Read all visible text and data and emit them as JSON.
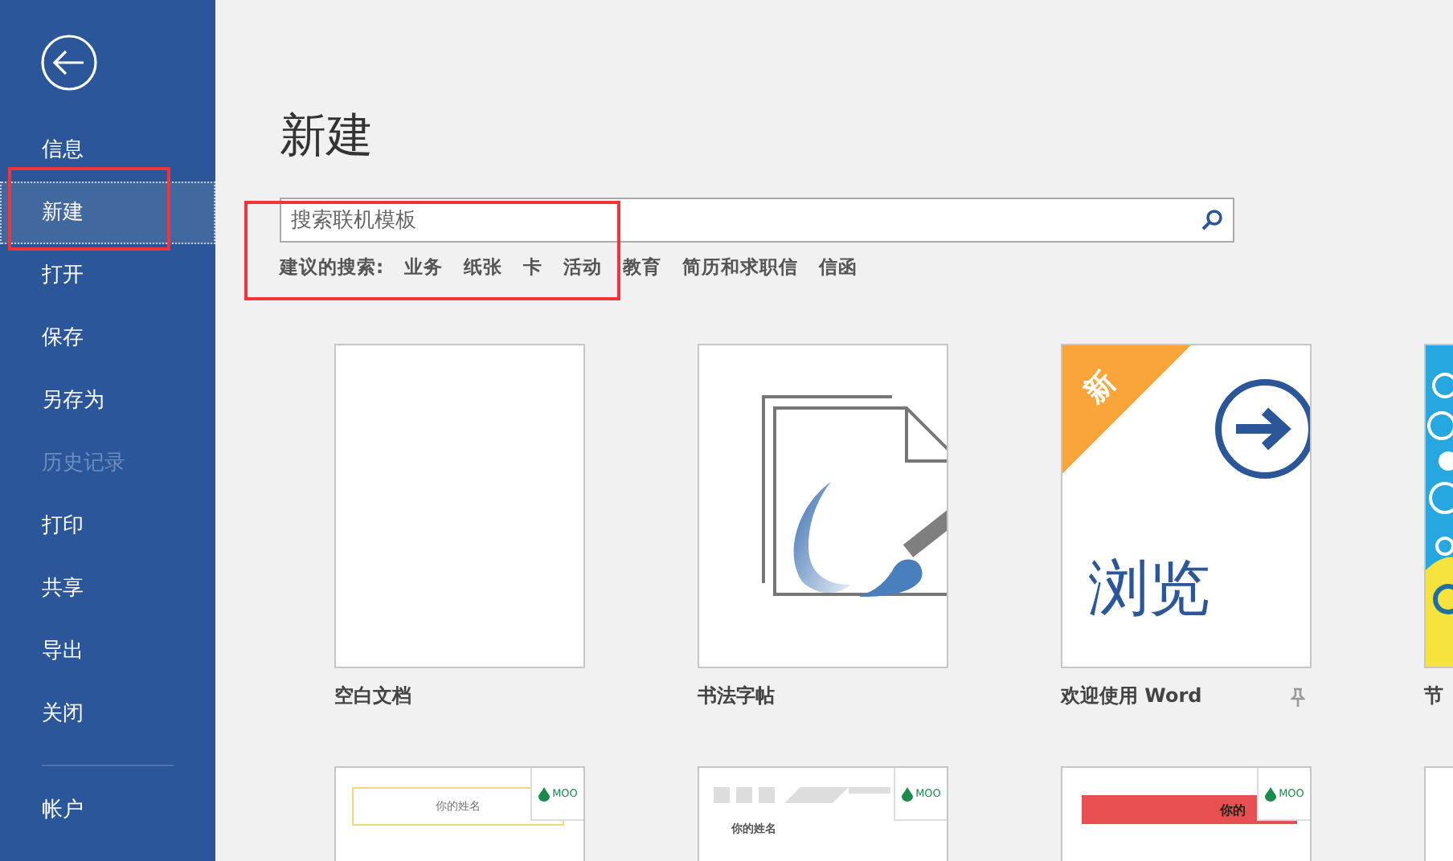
{
  "sidebar": {
    "items": [
      {
        "label": "信息",
        "selected": false,
        "disabled": false
      },
      {
        "label": "新建",
        "selected": true,
        "disabled": false
      },
      {
        "label": "打开",
        "selected": false,
        "disabled": false
      },
      {
        "label": "保存",
        "selected": false,
        "disabled": false
      },
      {
        "label": "另存为",
        "selected": false,
        "disabled": false
      },
      {
        "label": "历史记录",
        "selected": false,
        "disabled": true
      },
      {
        "label": "打印",
        "selected": false,
        "disabled": false
      },
      {
        "label": "共享",
        "selected": false,
        "disabled": false
      },
      {
        "label": "导出",
        "selected": false,
        "disabled": false
      },
      {
        "label": "关闭",
        "selected": false,
        "disabled": false
      }
    ],
    "footer_items": [
      {
        "label": "帐户",
        "selected": false,
        "disabled": false
      }
    ]
  },
  "main": {
    "title": "新建",
    "search": {
      "placeholder": "搜索联机模板"
    },
    "suggestions": {
      "label": "建议的搜索:",
      "tags": [
        "业务",
        "纸张",
        "卡",
        "活动",
        "教育",
        "简历和求职信",
        "信函"
      ]
    },
    "templates": [
      {
        "kind": "blank",
        "label": "空白文档",
        "pinned": false
      },
      {
        "kind": "calligraphy",
        "label": "书法字帖",
        "pinned": false
      },
      {
        "kind": "tour",
        "label": "欢迎使用 Word",
        "badge": "新",
        "art_text": "浏览",
        "pinned": true
      },
      {
        "kind": "festive",
        "label": "节"
      }
    ],
    "more_templates": [
      {
        "kind": "card-frame",
        "brand": "MOO",
        "name_text": "你的姓名"
      },
      {
        "kind": "card-stripes",
        "brand": "MOO",
        "name_text": "你的姓名"
      },
      {
        "kind": "card-red",
        "brand": "MOO",
        "name_text": "你的"
      },
      {
        "kind": "plain"
      }
    ]
  }
}
